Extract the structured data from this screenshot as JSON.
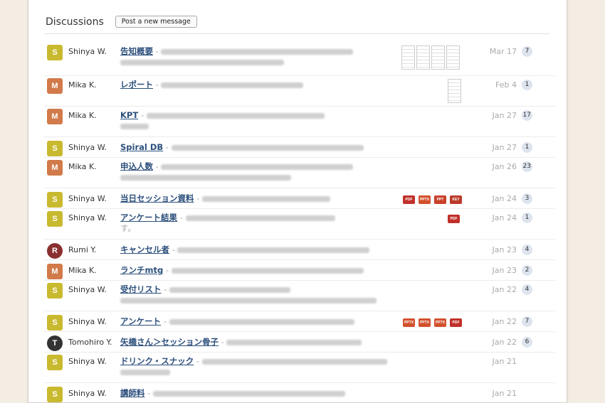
{
  "header": {
    "title": "Discussions",
    "post_button": "Post a new message"
  },
  "colors": {
    "link": "#2c4f7c",
    "count_badge": "#dde4ee",
    "background": "#f3ede4"
  },
  "rows": [
    {
      "author": "Shinya W.",
      "subject": "告知概要",
      "date": "Mar 17",
      "count": "7"
    },
    {
      "author": "Mika K.",
      "subject": "レポート",
      "date": "Feb 4",
      "count": "1"
    },
    {
      "author": "Mika K.",
      "subject": "KPT",
      "date": "Jan 27",
      "count": "17"
    },
    {
      "author": "Shinya W.",
      "subject": "Spiral DB",
      "date": "Jan 27",
      "count": "1"
    },
    {
      "author": "Mika K.",
      "subject": "申込人数",
      "date": "Jan 26",
      "count": "23"
    },
    {
      "author": "Shinya W.",
      "subject": "当日セッション資料",
      "date": "Jan 24",
      "count": "3",
      "files": [
        "PDF",
        "PPTX",
        "PPT",
        "KEY"
      ]
    },
    {
      "author": "Shinya W.",
      "subject": "アンケート結果",
      "excerpt_tail": "す。",
      "date": "Jan 24",
      "count": "1",
      "files": [
        "PDF"
      ]
    },
    {
      "author": "Rumi Y.",
      "subject": "キャンセル者",
      "date": "Jan 23",
      "count": "4"
    },
    {
      "author": "Mika K.",
      "subject": "ランチmtg",
      "date": "Jan 23",
      "count": "2"
    },
    {
      "author": "Shinya W.",
      "subject": "受付リスト",
      "date": "Jan 22",
      "count": "4"
    },
    {
      "author": "Shinya W.",
      "subject": "アンケート",
      "date": "Jan 22",
      "count": "7",
      "files": [
        "PPTX",
        "PPTX",
        "PPTX",
        "PDF"
      ]
    },
    {
      "author": "Tomohiro Y.",
      "subject": "矢橋さん＞セッション骨子",
      "date": "Jan 22",
      "count": "6"
    },
    {
      "author": "Shinya W.",
      "subject": "ドリンク・スナック",
      "date": "Jan 21",
      "count": ""
    },
    {
      "author": "Shinya W.",
      "subject": "講師料",
      "date": "Jan 21",
      "count": ""
    }
  ]
}
